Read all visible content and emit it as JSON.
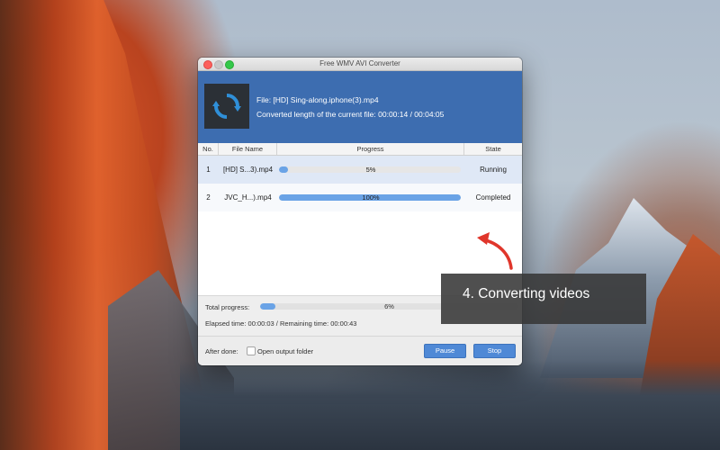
{
  "window": {
    "title": "Free WMV AVI Converter"
  },
  "header": {
    "file_label": "File: [HD] Sing-along.iphone(3).mp4",
    "length_label": "Converted length of the current file: 00:00:14 / 00:04:05"
  },
  "table": {
    "columns": [
      "No.",
      "File Name",
      "Progress",
      "State"
    ],
    "rows": [
      {
        "no": "1",
        "name": "[HD] S...3).mp4",
        "progress": 5,
        "progress_text": "5%",
        "state": "Running"
      },
      {
        "no": "2",
        "name": "JVC_H...).mp4",
        "progress": 100,
        "progress_text": "100%",
        "state": "Completed"
      }
    ]
  },
  "total": {
    "label": "Total progress:",
    "progress": 6,
    "progress_text": "6%",
    "elapsed": "Elapsed time: 00:00:03 / Remaining time: 00:00:43"
  },
  "footer": {
    "after_done": "After done:",
    "checkbox_label": "Open output folder",
    "checkbox_checked": false,
    "pause": "Pause",
    "stop": "Stop"
  },
  "overlay": {
    "caption": "4. Converting videos"
  },
  "colors": {
    "accent": "#3d6db0",
    "progress": "#6aa3e6",
    "arrow": "#e0362b"
  }
}
